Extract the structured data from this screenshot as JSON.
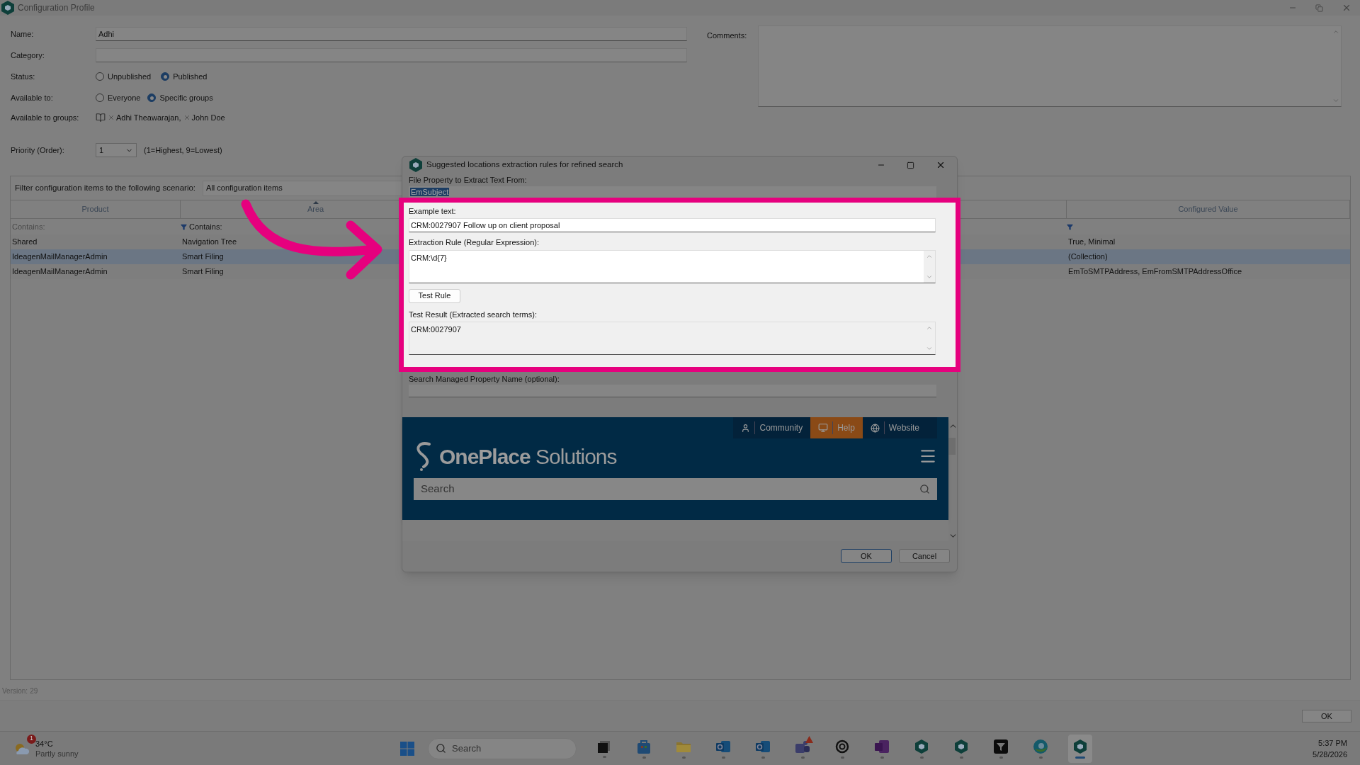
{
  "window": {
    "title": "Configuration Profile"
  },
  "form": {
    "name": {
      "label": "Name:",
      "value": "Adhi"
    },
    "category": {
      "label": "Category:"
    },
    "status": {
      "label": "Status:",
      "options": [
        {
          "label": "Unpublished",
          "selected": false
        },
        {
          "label": "Published",
          "selected": true
        }
      ]
    },
    "available_to": {
      "label": "Available to:",
      "options": [
        {
          "label": "Everyone",
          "selected": false
        },
        {
          "label": "Specific groups",
          "selected": true
        }
      ]
    },
    "available_to_groups": {
      "label": "Available to groups:",
      "groups": [
        "Adhi Theawarajan,",
        "John  Doe"
      ]
    },
    "priority": {
      "label": "Priority (Order):",
      "value": "1",
      "hint": "(1=Highest, 9=Lowest)"
    },
    "comments": {
      "label": "Comments:"
    }
  },
  "filter": {
    "label": "Filter configuration items to the following scenario:",
    "value": "All configuration items"
  },
  "table": {
    "columns": [
      {
        "label": "Product",
        "sorted": false
      },
      {
        "label": "Area",
        "sorted": true
      },
      {
        "label": "Configured Value",
        "sorted": false
      }
    ],
    "filters": [
      {
        "text": "Contains:",
        "filtered": false
      },
      {
        "text": "Contains:",
        "filtered": true
      },
      {
        "filtered": true
      }
    ],
    "rows": [
      {
        "cells": [
          "Shared",
          "Navigation Tree",
          "True, Minimal"
        ],
        "selected": false
      },
      {
        "cells": [
          "IdeagenMailManagerAdmin",
          "Smart Filing",
          "(Collection)"
        ],
        "selected": true
      },
      {
        "cells": [
          "IdeagenMailManagerAdmin",
          "Smart Filing",
          "EmToSMTPAddress, EmFromSMTPAddressOffice"
        ],
        "selected": false
      }
    ]
  },
  "version": {
    "label": "Version:",
    "value": "29"
  },
  "buttons": [
    "OK"
  ],
  "dialog": {
    "title": "Suggested locations extraction rules for refined search",
    "file_property": {
      "label": "File Property to Extract Text From:",
      "value": "EmSubject"
    },
    "example_text": {
      "label": "Example text:",
      "value": "CRM:0027907 Follow up on client proposal"
    },
    "extraction_rule": {
      "label": "Extraction Rule (Regular Expression):",
      "value": "CRM:\\d{7}"
    },
    "test_button": "Test Rule",
    "test_result": {
      "label": "Test Result (Extracted search terms):",
      "value": "CRM:0027907"
    },
    "managed_property": {
      "label": "Search Managed Property Name (optional):"
    },
    "web_panel": {
      "nav": [
        {
          "label": "Community",
          "kind": "person",
          "selected": false
        },
        {
          "label": "Help",
          "kind": "monitor",
          "selected": true
        },
        {
          "label": "Website",
          "kind": "globe",
          "selected": false
        }
      ],
      "logo": {
        "bold": "OnePlace",
        "light": "Solutions"
      },
      "search": {
        "placeholder": "Search"
      }
    },
    "buttons": [
      "OK",
      "Cancel"
    ]
  },
  "taskbar": {
    "weather": {
      "badge": "1",
      "temperature": "34°C",
      "condition": "Partly sunny"
    },
    "search": {
      "placeholder": "Search"
    },
    "apps": [
      {
        "kind": "windows",
        "active": false
      },
      {
        "kind": "taskview",
        "active": false
      },
      {
        "kind": "store",
        "active": false
      },
      {
        "kind": "folder",
        "active": false
      },
      {
        "kind": "mail",
        "active": false
      },
      {
        "kind": "mail",
        "active": false
      },
      {
        "kind": "teams",
        "active": false
      },
      {
        "kind": "ring",
        "active": false
      },
      {
        "kind": "notebook",
        "active": false
      },
      {
        "kind": "hex",
        "active": false
      },
      {
        "kind": "hex",
        "active": false
      },
      {
        "kind": "funnel",
        "active": false
      },
      {
        "kind": "browser",
        "active": false
      },
      {
        "kind": "hex",
        "active": true
      }
    ],
    "clock": {
      "time": "5:37 PM",
      "date": "5/28/2026"
    }
  }
}
